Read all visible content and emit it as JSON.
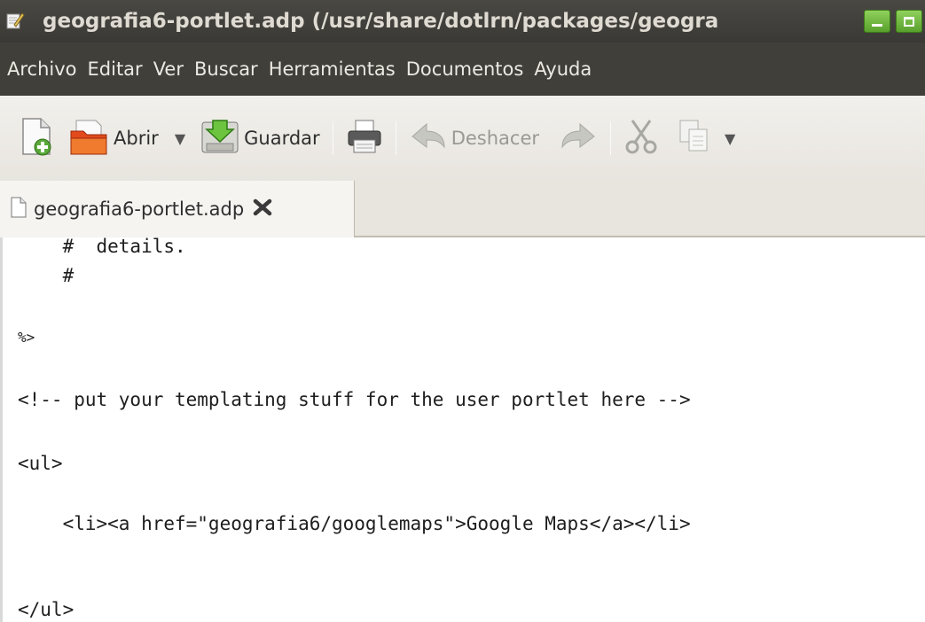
{
  "window": {
    "title": "geografia6-portlet.adp (/usr/share/dotlrn/packages/geogra"
  },
  "menu": [
    "Archivo",
    "Editar",
    "Ver",
    "Buscar",
    "Herramientas",
    "Documentos",
    "Ayuda"
  ],
  "toolbar": {
    "open_label": "Abrir",
    "save_label": "Guardar",
    "undo_label": "Deshacer"
  },
  "tab": {
    "label": "geografia6-portlet.adp"
  },
  "editor": {
    "lines": [
      "    #  details.",
      "    #",
      "",
      "%>",
      "",
      "<!-- put your templating stuff for the user portlet here -->",
      "",
      "<ul>",
      "",
      "    <li><a href=\"geografia6/googlemaps\">Google Maps</a></li>",
      "",
      "",
      "</ul>"
    ]
  },
  "colors": {
    "titlebar": "#3f3e3a",
    "menubar": "#403f3a",
    "toolbar": "#efede9",
    "window_buttons": "#6fbb3f"
  },
  "icons": {
    "title": "text-editor-icon",
    "new": "new-document-icon",
    "open": "open-folder-icon",
    "save": "save-icon",
    "print": "printer-icon",
    "undo": "undo-icon",
    "redo": "redo-icon",
    "cut": "scissors-icon",
    "copy": "copy-icon",
    "tab_file": "file-icon",
    "tab_close": "close-icon"
  }
}
